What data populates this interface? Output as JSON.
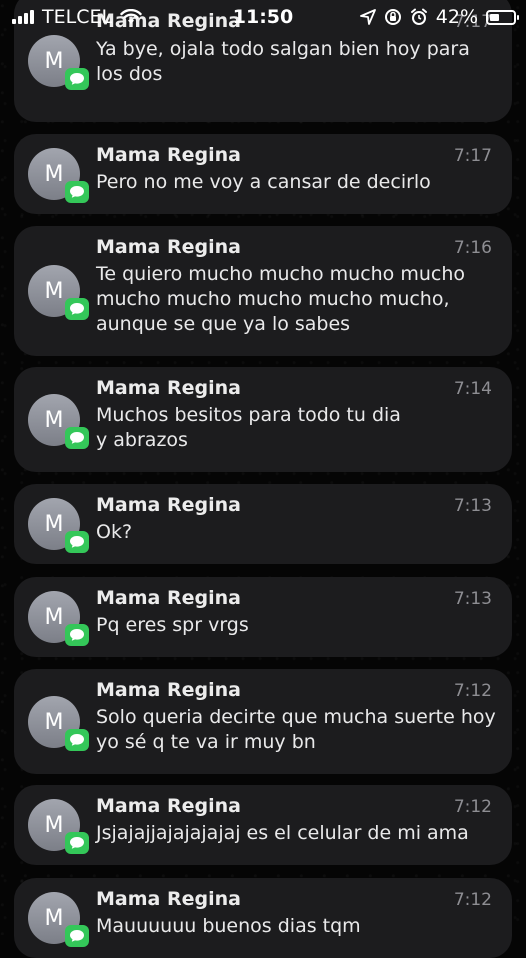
{
  "status_bar": {
    "carrier": "TELCEL",
    "time": "11:50",
    "battery_percent": "42%",
    "battery_level": 0.42
  },
  "notifications": [
    {
      "avatar_initial": "M",
      "sender": "Mama Regina",
      "time": "7:17",
      "body": "Ya bye, ojala todo salgan bien hoy para los dos",
      "app_icon": "messages-icon"
    },
    {
      "avatar_initial": "M",
      "sender": "Mama Regina",
      "time": "7:17",
      "body": "Pero no me voy a cansar de decirlo",
      "app_icon": "messages-icon"
    },
    {
      "avatar_initial": "M",
      "sender": "Mama Regina",
      "time": "7:16",
      "body": "Te quiero mucho mucho mucho mucho mucho mucho mucho mucho mucho, aunque se que ya lo sabes",
      "app_icon": "messages-icon"
    },
    {
      "avatar_initial": "M",
      "sender": "Mama Regina",
      "time": "7:14",
      "body": "Muchos besitos para todo tu dia\ny abrazos",
      "app_icon": "messages-icon"
    },
    {
      "avatar_initial": "M",
      "sender": "Mama Regina",
      "time": "7:13",
      "body": "Ok?",
      "app_icon": "messages-icon"
    },
    {
      "avatar_initial": "M",
      "sender": "Mama Regina",
      "time": "7:13",
      "body": "Pq eres spr vrgs",
      "app_icon": "messages-icon"
    },
    {
      "avatar_initial": "M",
      "sender": "Mama Regina",
      "time": "7:12",
      "body": "Solo queria decirte que mucha suerte hoy yo sé q te va ir muy bn",
      "app_icon": "messages-icon"
    },
    {
      "avatar_initial": "M",
      "sender": "Mama Regina",
      "time": "7:12",
      "body": "Jsjajajjajajajajaj es el celular de mi ama",
      "app_icon": "messages-icon"
    },
    {
      "avatar_initial": "M",
      "sender": "Mama Regina",
      "time": "7:12",
      "body": "Mauuuuuu buenos dias tqm",
      "app_icon": "messages-icon"
    }
  ]
}
